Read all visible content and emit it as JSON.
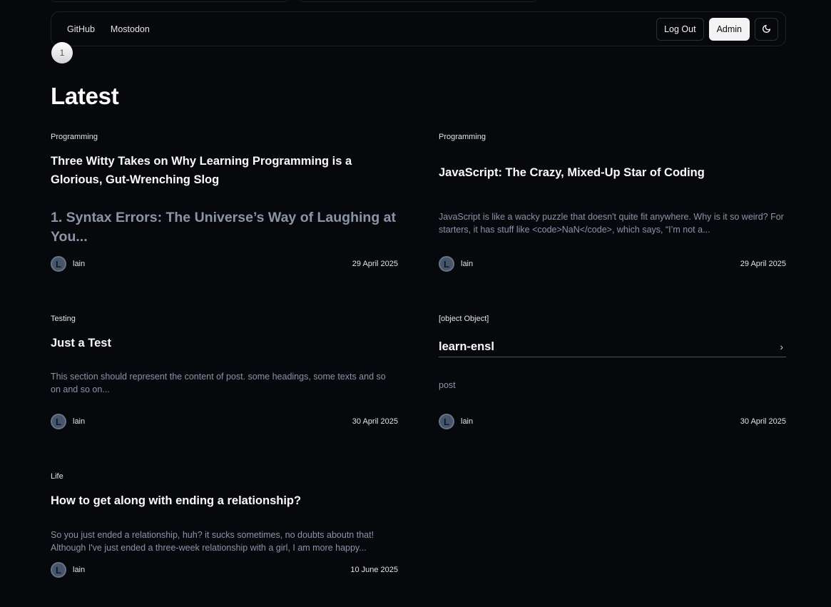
{
  "nav": {
    "links": [
      "GitHub",
      "Mostodon"
    ],
    "logout_label": "Log Out",
    "admin_label": "Admin",
    "theme_icon": "moon-icon"
  },
  "pagination": {
    "current_page": "1"
  },
  "section_title": "Latest",
  "posts": [
    {
      "category": "Programming",
      "title": "Three Witty Takes on Why Learning Programming is a Glorious, Gut-Wrenching Slog",
      "excerpt_heading": "1. Syntax Errors: The Universe’s Way of Laughing at You...",
      "author": "lain",
      "avatar_initial": "L",
      "date": "29 April 2025"
    },
    {
      "category": "Programming",
      "title": "JavaScript: The Crazy, Mixed-Up Star of Coding",
      "excerpt": "JavaScript is like a wacky puzzle that doesn't quite fit anywhere. Why is it so weird? For starters, it has stuff like <code>NaN</code>, which says, “I’m not a...",
      "author": "lain",
      "avatar_initial": "L",
      "date": "29 April 2025"
    },
    {
      "category": "Testing",
      "title": "Just a Test",
      "excerpt": "This section should represent the content of post. some headings, some texts and so on and so on...",
      "author": "lain",
      "avatar_initial": "L",
      "date": "30 April 2025"
    },
    {
      "category": "[object Object]",
      "link_title": "learn-ensl",
      "excerpt": "post",
      "author": "lain",
      "avatar_initial": "L",
      "date": "30 April 2025"
    },
    {
      "category": "Life",
      "title": "How to get along with ending a relationship?",
      "excerpt": "So you just ended a relationship, huh? it sucks sometimes, no doubts aboutn that! Although I've just ended a three-week relationship with a girl, I am more happy...",
      "author": "lain",
      "avatar_initial": "L",
      "date": "10 June 2025"
    }
  ],
  "colors": {
    "background": "#07080c",
    "muted_text": "#8b95a7",
    "border": "#1f2127"
  }
}
